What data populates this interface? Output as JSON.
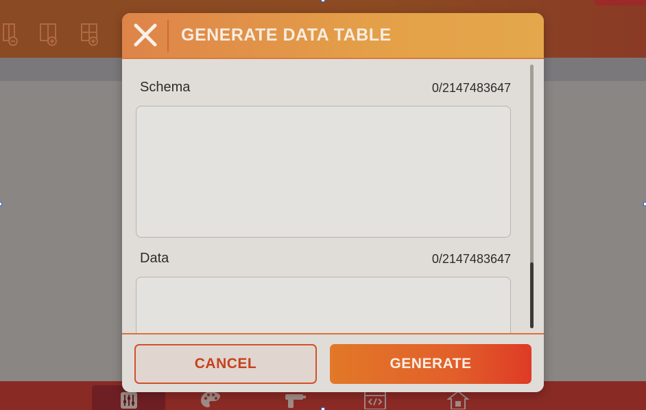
{
  "background": {
    "toolbar_icons": [
      "table-remove-column-icon",
      "table-add-column-icon",
      "table-add-row-icon"
    ],
    "bottom_tabs": [
      {
        "icon": "sliders-icon",
        "active": true
      },
      {
        "icon": "palette-icon",
        "active": false
      },
      {
        "icon": "gun-tool-icon",
        "active": false
      },
      {
        "icon": "code-window-icon",
        "active": false
      },
      {
        "icon": "home-icon",
        "active": false
      }
    ]
  },
  "dialog": {
    "title": "GENERATE DATA TABLE",
    "close_icon": "close-icon",
    "fields": [
      {
        "label": "Schema",
        "counter": "0/2147483647",
        "value": ""
      },
      {
        "label": "Data",
        "counter": "0/2147483647",
        "value": ""
      }
    ],
    "scroll_position": 0.75,
    "buttons": {
      "cancel": "CANCEL",
      "generate": "GENERATE"
    }
  },
  "colors": {
    "accent": "#e2602a",
    "header_start": "#de8449",
    "header_end": "#e4a74b",
    "bottom_bar": "#8a2a25"
  }
}
